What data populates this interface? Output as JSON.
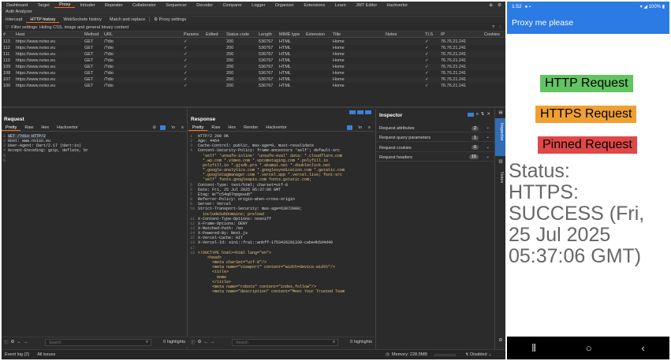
{
  "burp": {
    "top_tabs": [
      "Dashboard",
      "Target",
      "Proxy",
      "Intruder",
      "Repeater",
      "Collaborator",
      "Sequencer",
      "Decoder",
      "Comparer",
      "Logger",
      "Organizer",
      "Extensions",
      "Learn",
      "JWT Editor",
      "Hackvertor"
    ],
    "auth_analyzer": "Auth Analyzer",
    "proxy_tabs": [
      "Intercept",
      "HTTP history",
      "WebSockets history",
      "Match and replace"
    ],
    "proxy_settings": "Proxy settings",
    "filter_text": "Filter settings: Hiding CSS, image and general binary content",
    "columns": [
      "#",
      "Host",
      "Method",
      "URL",
      "Params",
      "Edited",
      "Status code",
      "Length",
      "MIME type",
      "Extension",
      "Title",
      "Notes",
      "TLS",
      "IP",
      "Cookies"
    ],
    "rows": [
      [
        "113",
        "https://www.nviso.eu",
        "GET",
        "/?dio",
        "✓",
        "",
        "200",
        "536767",
        "HTML",
        "",
        "Home",
        "",
        "✓",
        "76.76.21.241"
      ],
      [
        "112",
        "https://www.nviso.eu",
        "GET",
        "/?dio",
        "✓",
        "",
        "200",
        "536767",
        "HTML",
        "",
        "Home",
        "",
        "✓",
        "76.76.21.241"
      ],
      [
        "111",
        "https://www.nviso.eu",
        "GET",
        "/?dio",
        "✓",
        "",
        "200",
        "536767",
        "HTML",
        "",
        "Home",
        "",
        "✓",
        "76.76.21.241"
      ],
      [
        "110",
        "https://www.nviso.eu",
        "GET",
        "/?dio",
        "✓",
        "",
        "200",
        "536767",
        "HTML",
        "",
        "Home",
        "",
        "✓",
        "76.76.21.241"
      ],
      [
        "109",
        "https://www.nviso.eu",
        "GET",
        "/?dio",
        "✓",
        "",
        "200",
        "536767",
        "HTML",
        "",
        "Home",
        "",
        "✓",
        "76.76.21.241"
      ],
      [
        "108",
        "https://www.nviso.eu",
        "GET",
        "/?dio",
        "✓",
        "",
        "200",
        "536767",
        "HTML",
        "",
        "Home",
        "",
        "✓",
        "76.76.21.241"
      ],
      [
        "107",
        "https://www.nviso.eu",
        "GET",
        "/?dio",
        "✓",
        "",
        "200",
        "536767",
        "HTML",
        "",
        "Home",
        "",
        "✓",
        "76.76.21.241"
      ],
      [
        "106",
        "https://www.nviso.eu",
        "GET",
        "/?dio",
        "✓",
        "",
        "200",
        "536767",
        "HTML",
        "",
        "Home",
        "",
        "✓",
        "76.76.21.241"
      ]
    ],
    "request": {
      "title": "Request",
      "tabs": [
        "Pretty",
        "Raw",
        "Hex",
        "Hackvertor"
      ],
      "lines": [
        "GET /?dio HTTP/2",
        "Host: www.nviso.eu",
        "User-Agent: Dart/2.17 (dart:io)",
        "Accept-Encoding: gzip, deflate, br",
        "",
        ""
      ]
    },
    "response": {
      "title": "Response",
      "tabs": [
        "Pretty",
        "Raw",
        "Hex",
        "Render",
        "Hackvertor"
      ],
      "lines": [
        [
          "1",
          "HTTP/2 200 OK"
        ],
        [
          "2",
          "Age: 4464"
        ],
        [
          "3",
          "Cache-Control: public, max-age=0, must-revalidate"
        ],
        [
          "4",
          "Content-Security-Policy: frame-ancestors 'self'; default-src"
        ],
        [
          "",
          "  'self' 'unsafe-inline' 'unsafe-eval' data: *.cloudflare.com"
        ],
        [
          "",
          "  *.wp.com *.vimeo.com *.vpcomstaging.com *.polyfill.io"
        ],
        [
          "",
          "  polyfill.io *.gjsdk.pro *.akamai.net *.doubleclick.net"
        ],
        [
          "",
          "  *.google-analytics.com *.googlesyndication.com *.gstatic.com"
        ],
        [
          "",
          "  *.googletagmanager.com *.vercel.app *.vercel.live; font-src"
        ],
        [
          "",
          "  'self' fonts.googleapis.com fonts.gstatic.com;"
        ],
        [
          "5",
          "Content-Type: text/html; charset=utf-8"
        ],
        [
          "6",
          "Date: Fri, 25 Jul 2025 05:37:06 GMT"
        ],
        [
          "7",
          "Etag: W/\"c54q67opgsuub\""
        ],
        [
          "8",
          "Referrer-Policy: origin-when-cross-origin"
        ],
        [
          "9",
          "Server: Vercel"
        ],
        [
          "10",
          "Strict-Transport-Security: max-age=63072000;"
        ],
        [
          "",
          "  includeSubDomains; preload"
        ],
        [
          "11",
          "X-Content-Type-Options: nosniff"
        ],
        [
          "12",
          "X-Frame-Options: DENY"
        ],
        [
          "13",
          "X-Matched-Path: /en"
        ],
        [
          "14",
          "X-Powered-By: Next.js"
        ],
        [
          "15",
          "X-Vercel-Cache: HIT"
        ],
        [
          "16",
          "X-Vercel-Id: sin1::fra1::wnbff-1753426291330-cabe4b5d4d49"
        ],
        [
          "17",
          ""
        ],
        [
          "18",
          "<!DOCTYPE html><html lang=\"en\">"
        ],
        [
          "",
          "    <head>"
        ],
        [
          "",
          "      <meta charSet=\"utf-8\"/>"
        ],
        [
          "",
          "      <meta name=\"viewport\" content=\"width=device-width\"/>"
        ],
        [
          "",
          "      <title>"
        ],
        [
          "",
          "        Home"
        ],
        [
          "",
          "      </title>"
        ],
        [
          "",
          "      <meta name=\"robots\" content=\"index,follow\"/>"
        ],
        [
          "",
          "      <meta name=\"description\" content=\"Meet Your Trusted Team"
        ]
      ]
    },
    "inspector": {
      "title": "Inspector",
      "rows": [
        {
          "label": "Request attributes",
          "count": "2"
        },
        {
          "label": "Request query parameters",
          "count": "1"
        },
        {
          "label": "Request cookies",
          "count": "0"
        },
        {
          "label": "Request headers",
          "count": "15"
        }
      ]
    },
    "side_tabs": [
      "Inspector",
      "Notes"
    ],
    "search_placeholder": "Search",
    "highlights": "0 highlights",
    "status_bar": {
      "event_log": "Event log (2)",
      "all_issues": "All issues",
      "memory": "Memory: 228.9MB",
      "disabled": "Disabled"
    }
  },
  "phone": {
    "time": "1:52",
    "battery": "100%",
    "app_title": "Proxy me please",
    "buttons": [
      {
        "label": "HTTP Request",
        "color": "#62c462"
      },
      {
        "label": "HTTPS Request",
        "color": "#f0a030"
      },
      {
        "label": "Pinned Request",
        "color": "#e04848"
      }
    ],
    "status_text": "Status:\nHTTPS:\nSUCCESS (Fri,\n25 Jul 2025\n05:37:06 GMT)"
  }
}
